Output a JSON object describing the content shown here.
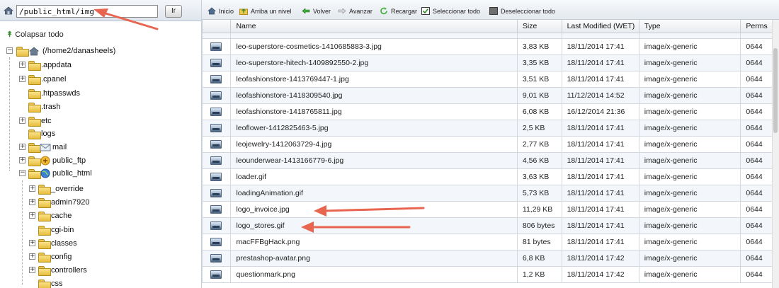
{
  "path_bar": {
    "path_value": "/public_html/img",
    "go_label": "Ir"
  },
  "tree": {
    "collapse_label": "Colapsar todo",
    "root_label": "(/home2/danasheels)",
    "items": [
      {
        "label": ".appdata",
        "expandable": true
      },
      {
        "label": ".cpanel",
        "expandable": true
      },
      {
        "label": ".htpasswds",
        "expandable": false
      },
      {
        "label": ".trash",
        "expandable": false
      },
      {
        "label": "etc",
        "expandable": true
      },
      {
        "label": "logs",
        "expandable": false
      },
      {
        "label": "mail",
        "expandable": true,
        "icon": "mail-icon"
      },
      {
        "label": "public_ftp",
        "expandable": true,
        "icon": "ftp-icon"
      },
      {
        "label": "public_html",
        "expandable": true,
        "expanded": true,
        "icon": "globe-icon"
      }
    ],
    "public_html_children": [
      {
        "label": "_override",
        "expandable": true
      },
      {
        "label": "admin7920",
        "expandable": true
      },
      {
        "label": "cache",
        "expandable": true
      },
      {
        "label": "cgi-bin",
        "expandable": false
      },
      {
        "label": "classes",
        "expandable": true
      },
      {
        "label": "config",
        "expandable": true
      },
      {
        "label": "controllers",
        "expandable": true
      },
      {
        "label": "css",
        "expandable": false
      }
    ]
  },
  "toolbar": {
    "home": "Inicio",
    "up": "Arriba un nivel",
    "back": "Volver",
    "forward": "Avanzar",
    "reload": "Recargar",
    "select_all": "Seleccionar todo",
    "deselect_all": "Deseleccionar todo"
  },
  "table": {
    "columns": [
      "Name",
      "Size",
      "Last Modified (WET)",
      "Type",
      "Perms"
    ],
    "rows": [
      {
        "name": "leo-superstore-cosmetics-1410685883-3.jpg",
        "size": "3,83 KB",
        "modified": "18/11/2014 17:41",
        "type": "image/x-generic",
        "perms": "0644"
      },
      {
        "name": "leo-superstore-hitech-1409892550-2.jpg",
        "size": "3,35 KB",
        "modified": "18/11/2014 17:41",
        "type": "image/x-generic",
        "perms": "0644"
      },
      {
        "name": "leofashionstore-1413769447-1.jpg",
        "size": "3,51 KB",
        "modified": "18/11/2014 17:41",
        "type": "image/x-generic",
        "perms": "0644"
      },
      {
        "name": "leofashionstore-1418309540.jpg",
        "size": "9,01 KB",
        "modified": "11/12/2014 14:52",
        "type": "image/x-generic",
        "perms": "0644"
      },
      {
        "name": "leofashionstore-1418765811.jpg",
        "size": "6,08 KB",
        "modified": "16/12/2014 21:36",
        "type": "image/x-generic",
        "perms": "0644"
      },
      {
        "name": "leoflower-1412825463-5.jpg",
        "size": "2,5 KB",
        "modified": "18/11/2014 17:41",
        "type": "image/x-generic",
        "perms": "0644"
      },
      {
        "name": "leojewelry-1412063729-4.jpg",
        "size": "2,77 KB",
        "modified": "18/11/2014 17:41",
        "type": "image/x-generic",
        "perms": "0644"
      },
      {
        "name": "leounderwear-1413166779-6.jpg",
        "size": "4,56 KB",
        "modified": "18/11/2014 17:41",
        "type": "image/x-generic",
        "perms": "0644"
      },
      {
        "name": "loader.gif",
        "size": "3,63 KB",
        "modified": "18/11/2014 17:41",
        "type": "image/x-generic",
        "perms": "0644"
      },
      {
        "name": "loadingAnimation.gif",
        "size": "5,73 KB",
        "modified": "18/11/2014 17:41",
        "type": "image/x-generic",
        "perms": "0644"
      },
      {
        "name": "logo_invoice.jpg",
        "size": "11,29 KB",
        "modified": "18/11/2014 17:41",
        "type": "image/x-generic",
        "perms": "0644"
      },
      {
        "name": "logo_stores.gif",
        "size": "806 bytes",
        "modified": "18/11/2014 17:41",
        "type": "image/x-generic",
        "perms": "0644"
      },
      {
        "name": "macFFBgHack.png",
        "size": "81 bytes",
        "modified": "18/11/2014 17:41",
        "type": "image/x-generic",
        "perms": "0644"
      },
      {
        "name": "prestashop-avatar.png",
        "size": "6,8 KB",
        "modified": "18/11/2014 17:42",
        "type": "image/x-generic",
        "perms": "0644"
      },
      {
        "name": "questionmark.png",
        "size": "1,2 KB",
        "modified": "18/11/2014 17:42",
        "type": "image/x-generic",
        "perms": "0644"
      }
    ]
  },
  "colors": {
    "annotation_arrow": "#e8654f",
    "alt_row": "#f3f6fa",
    "header_bg": "#e9ecef"
  }
}
